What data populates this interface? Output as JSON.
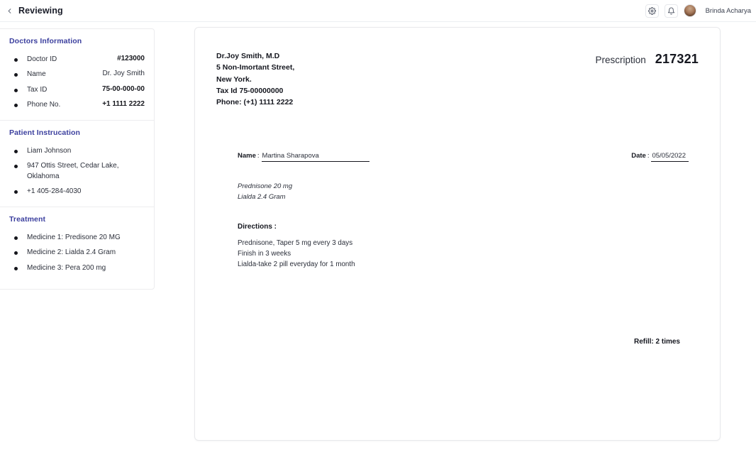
{
  "topbar": {
    "back_icon": "chevron-left-icon",
    "title": "Reviewing",
    "settings_icon": "gear-icon",
    "notifications_icon": "bell-icon",
    "user_name": "Brinda Acharya"
  },
  "sidebar": {
    "sections": [
      {
        "heading": "Doctors Information",
        "rows": [
          {
            "label": "Doctor ID",
            "value": "#123000",
            "bold": true
          },
          {
            "label": "Name",
            "value": "Dr. Joy Smith",
            "bold": false
          },
          {
            "label": "Tax ID",
            "value": "75-00-000-00",
            "bold": true
          },
          {
            "label": "Phone No.",
            "value": "+1 1111 2222",
            "bold": true
          }
        ]
      },
      {
        "heading": "Patient  Instrucation",
        "rows": [
          {
            "label": "Liam Johnson",
            "value": "",
            "bold": false
          },
          {
            "label": "947 Ottis Street, Cedar Lake, Oklahoma",
            "value": "",
            "bold": false
          },
          {
            "label": "+1 405-284-4030",
            "value": "",
            "bold": false
          }
        ]
      },
      {
        "heading": "Treatment",
        "rows": [
          {
            "label": "Medicine 1: Predisone 20 MG",
            "value": "",
            "bold": false
          },
          {
            "label": "Medicine 2: Lialda 2.4 Gram",
            "value": "",
            "bold": false
          },
          {
            "label": "Medicine 3: Pera 200 mg",
            "value": "",
            "bold": false
          }
        ]
      }
    ]
  },
  "prescription": {
    "clinic_lines": "Dr.Joy Smith, M.D\n5 Non-Imortant Street,\nNew York.\nTax Id 75-00000000\nPhone: (+1) 1111 2222",
    "rx_label": "Prescription",
    "rx_number": "217321",
    "name_label": "Name",
    "name_sep": ":",
    "name_value": "Martina Sharapova",
    "date_label": "Date",
    "date_sep": ":",
    "date_value": "05/05/2022",
    "medications": "Prednisone 20 mg\nLialda 2.4 Gram",
    "directions_title": "Directions :",
    "directions_lines": "Prednisone, Taper 5 mg every 3 days\nFinish in 3 weeks\nLialda-take 2 pill everyday for 1 month",
    "refill": "Refill: 2 times"
  },
  "colors": {
    "heading": "#3b3f9e",
    "text": "#15171f",
    "page_bg": "#ffffff"
  }
}
